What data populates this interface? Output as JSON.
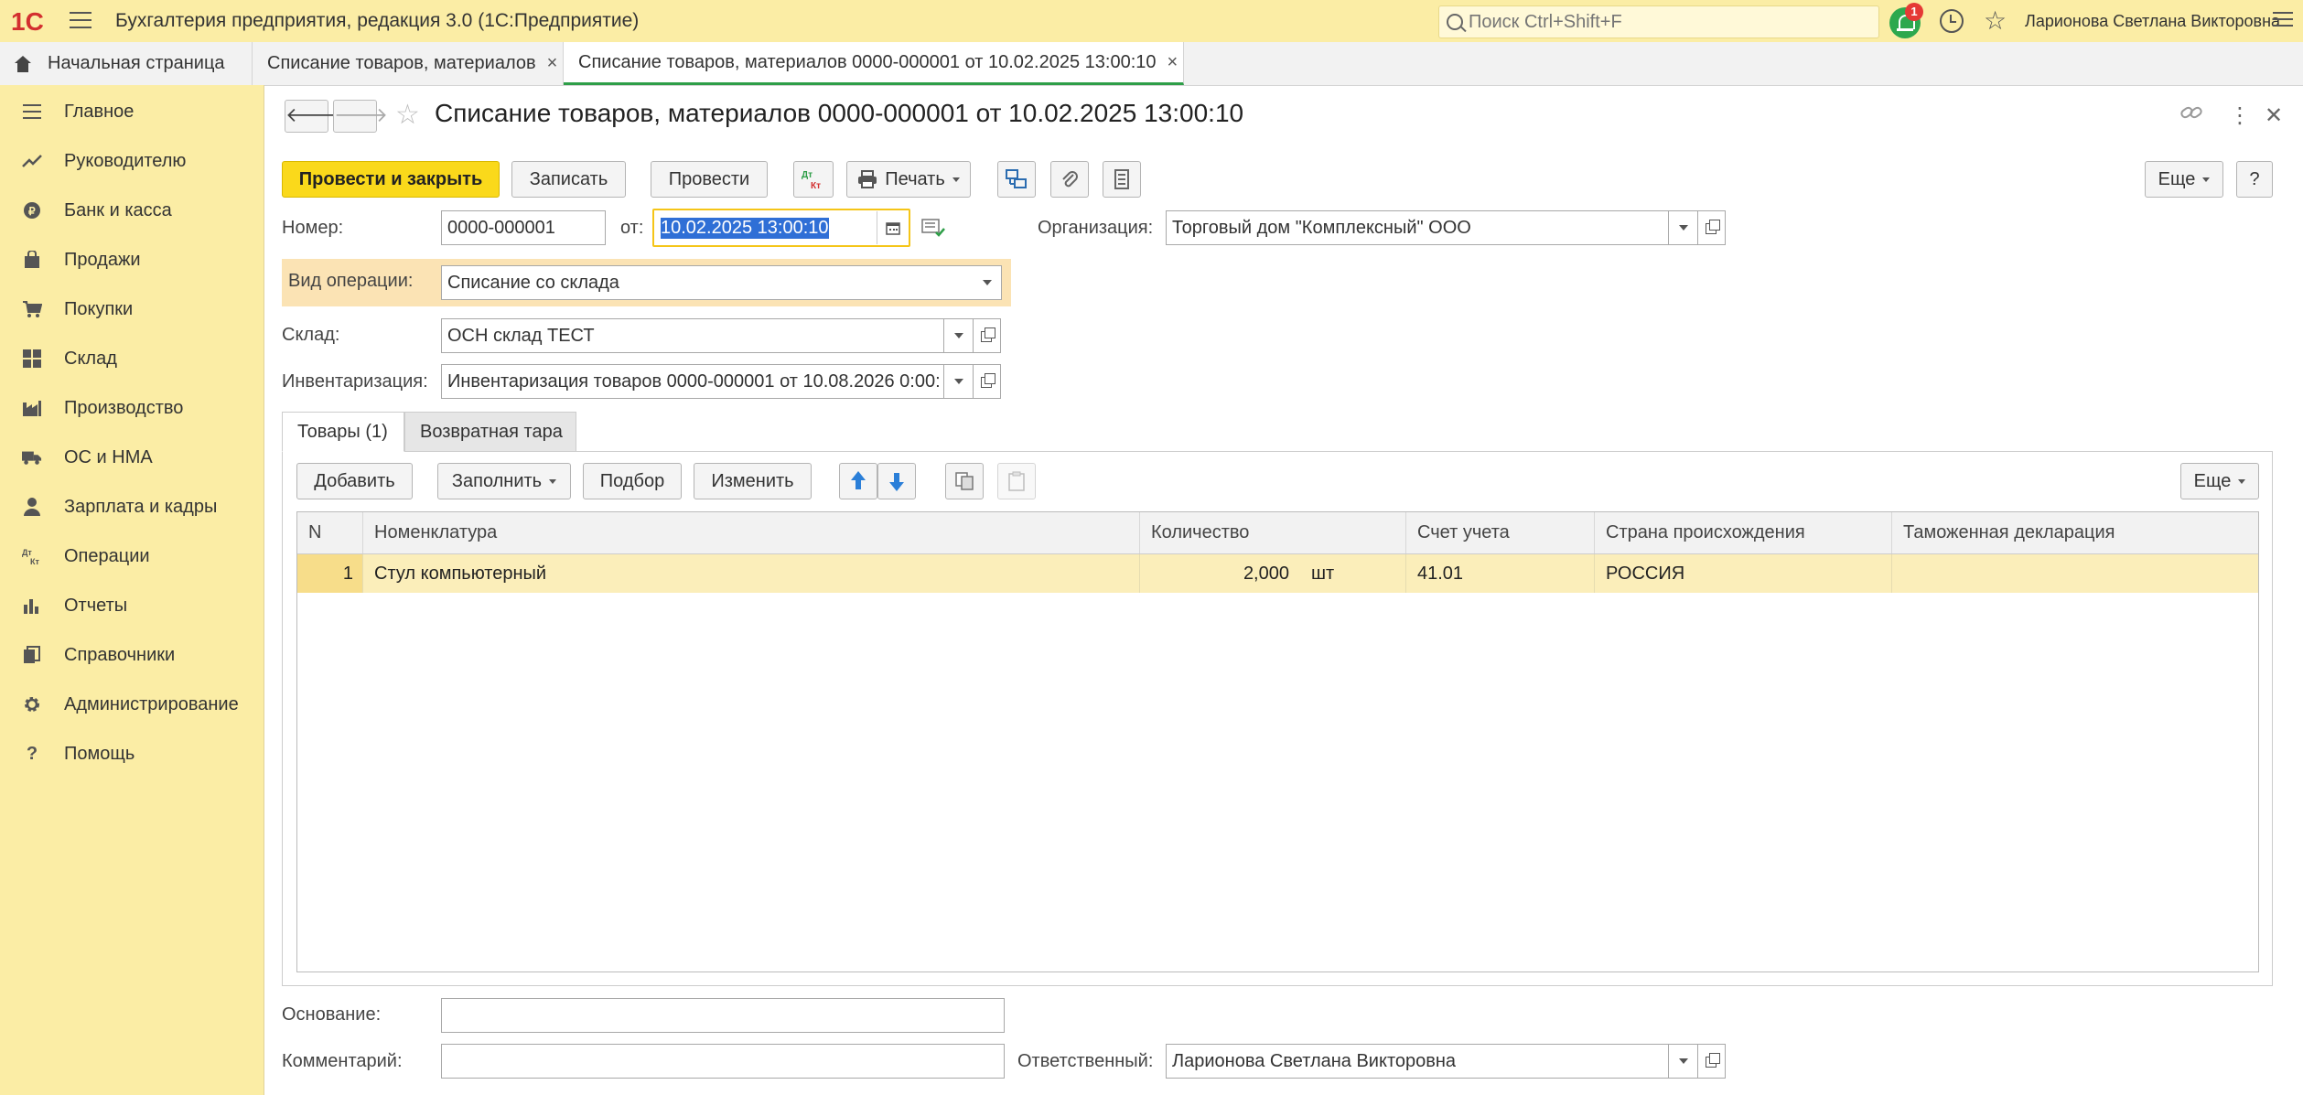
{
  "app": {
    "title": "Бухгалтерия предприятия, редакция 3.0  (1С:Предприятие)",
    "search_placeholder": "Поиск Ctrl+Shift+F",
    "notifications_count": "1",
    "user_name": "Ларионова Светлана Викторовна",
    "logo_text": "1С"
  },
  "tabs": [
    {
      "label": "Начальная страница"
    },
    {
      "label": "Списание товаров, материалов"
    },
    {
      "label": "Списание товаров, материалов 0000-000001 от 10.02.2025 13:00:10"
    }
  ],
  "sidebar": {
    "items": [
      {
        "label": "Главное",
        "icon": "menu-icon"
      },
      {
        "label": "Руководителю",
        "icon": "trend-icon"
      },
      {
        "label": "Банк и касса",
        "icon": "coin-icon"
      },
      {
        "label": "Продажи",
        "icon": "bag-icon"
      },
      {
        "label": "Покупки",
        "icon": "cart-icon"
      },
      {
        "label": "Склад",
        "icon": "warehouse-icon"
      },
      {
        "label": "Производство",
        "icon": "factory-icon"
      },
      {
        "label": "ОС и НМА",
        "icon": "truck-icon"
      },
      {
        "label": "Зарплата и кадры",
        "icon": "person-icon"
      },
      {
        "label": "Операции",
        "icon": "dt-kt-icon"
      },
      {
        "label": "Отчеты",
        "icon": "bar-chart-icon"
      },
      {
        "label": "Справочники",
        "icon": "books-icon"
      },
      {
        "label": "Администрирование",
        "icon": "gear-icon"
      },
      {
        "label": "Помощь",
        "icon": "question-icon"
      }
    ]
  },
  "document": {
    "title": "Списание товаров, материалов 0000-000001 от 10.02.2025 13:00:10"
  },
  "toolbar": {
    "post_close": "Провести и закрыть",
    "save": "Записать",
    "post": "Провести",
    "dtkt": "Дт Кт",
    "print": "Печать",
    "more": "Еще",
    "help": "?"
  },
  "form": {
    "number_label": "Номер:",
    "number_value": "0000-000001",
    "date_label": "от:",
    "date_value": "10.02.2025 13:00:10",
    "org_label": "Организация:",
    "org_value": "Торговый дом \"Комплексный\" ООО",
    "op_label": "Вид операции:",
    "op_value": "Списание со склада",
    "warehouse_label": "Склад:",
    "warehouse_value": "ОСН склад ТЕСТ",
    "inventory_label": "Инвентаризация:",
    "inventory_value": "Инвентаризация товаров 0000-000001 от 10.08.2026 0:00:",
    "basis_label": "Основание:",
    "basis_value": "",
    "comment_label": "Комментарий:",
    "comment_value": "",
    "responsible_label": "Ответственный:",
    "responsible_value": "Ларионова Светлана Викторовна"
  },
  "form_tabs": [
    {
      "label": "Товары (1)"
    },
    {
      "label": "Возвратная тара"
    }
  ],
  "table_toolbar": {
    "add": "Добавить",
    "fill": "Заполнить",
    "pick": "Подбор",
    "change": "Изменить",
    "more": "Еще"
  },
  "table": {
    "columns": [
      "N",
      "Номенклатура",
      "Количество",
      "Счет учета",
      "Страна происхождения",
      "Таможенная декларация"
    ],
    "rows": [
      {
        "n": "1",
        "item": "Стул компьютерный",
        "qty": "2,000",
        "unit": "шт",
        "account": "41.01",
        "country": "РОССИЯ",
        "declaration": ""
      }
    ]
  },
  "colors": {
    "sidebar_bg": "#fbeda5",
    "primary_button": "#fad91b",
    "selected_row": "#fbeeba",
    "active_tab_underline": "#2e9e48"
  }
}
